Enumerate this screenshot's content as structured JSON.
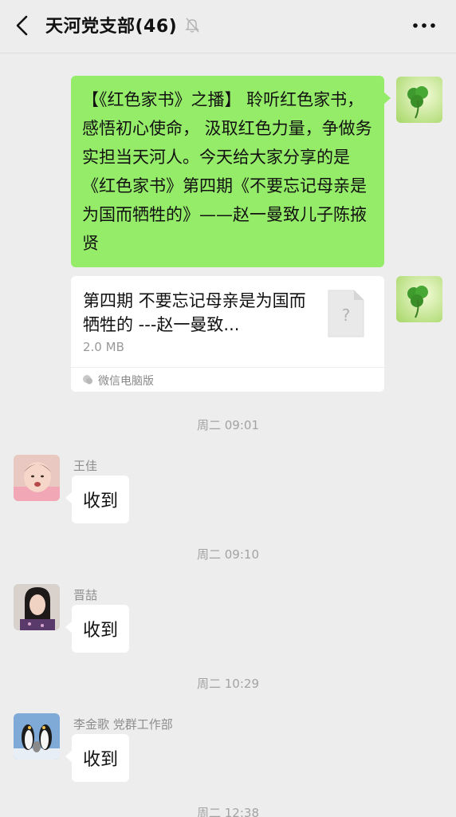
{
  "header": {
    "title": "天河党支部(46)"
  },
  "messages": {
    "outgoing_text": "【《红色家书》之播】 聆听红色家书，感悟初心使命， 汲取红色力量，争做务实担当天河人。今天给大家分享的是《红色家书》第四期《不要忘记母亲是为国而牺牲的》——赵一曼致儿子陈掖贤",
    "file": {
      "name": "第四期 不要忘记母亲是为国而牺牲的 ---赵一曼致...",
      "size": "2.0 MB",
      "source": "微信电脑版"
    },
    "replies": [
      {
        "time": "周二 09:01",
        "sender": "王佳",
        "text": "收到"
      },
      {
        "time": "周二 09:10",
        "sender": "晋喆",
        "text": "收到"
      },
      {
        "time": "周二 10:29",
        "sender": "李金歌 党群工作部",
        "text": "收到"
      }
    ],
    "last_time": "周二 12:38"
  },
  "colors": {
    "background": "#ededed",
    "bubble_green": "#95ec69",
    "bubble_white": "#ffffff"
  }
}
